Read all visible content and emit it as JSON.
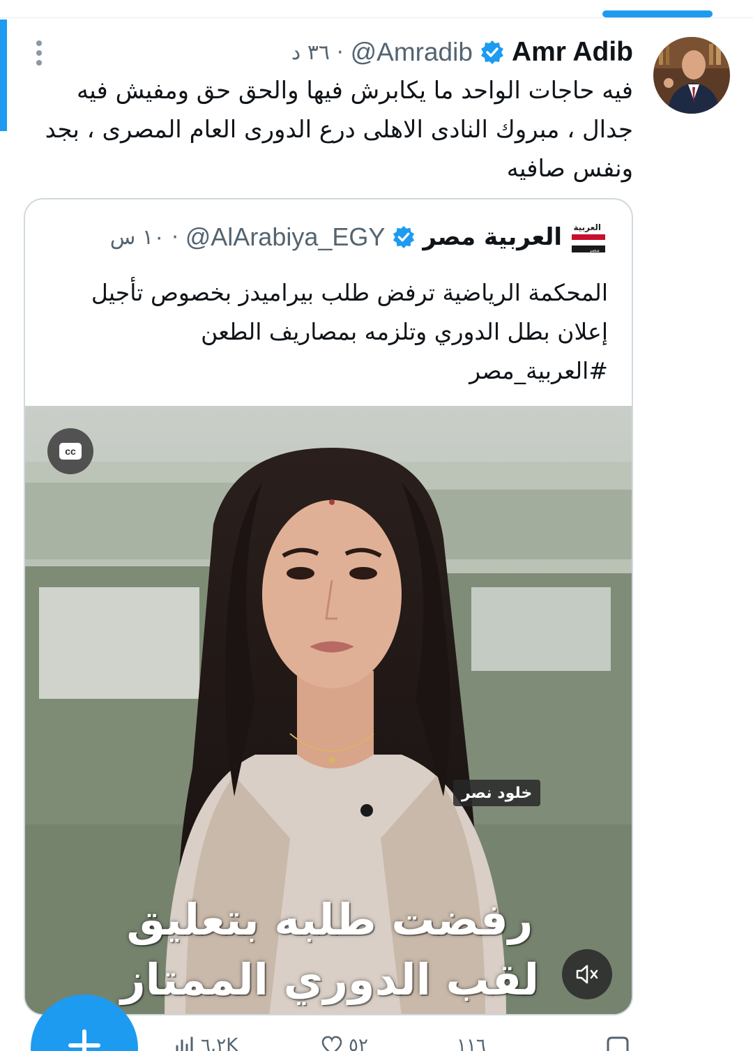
{
  "tweet": {
    "author_name": "Amr Adib",
    "handle": "@Amradib",
    "separator": "·",
    "time": "٣٦ د",
    "text_lines": [
      "فيه حاجات الواحد ما يكابرش فيها والحق حق ومفيش فيه",
      "جدال ، مبروك النادى الاهلى  درع الدورى العام المصرى ، بجد",
      "ونفس صافيه"
    ],
    "icons": {
      "verified": "verified-badge-icon",
      "more": "more-vertical-icon",
      "avatar": "profile-avatar"
    }
  },
  "quote": {
    "author_name": "العربية مصر",
    "handle": "@AlArabiya_EGY",
    "separator": "·",
    "time": "١٠ س",
    "text_lines": [
      "المحكمة الرياضية ترفض طلب بيراميدز بخصوص تأجيل",
      "إعلان بطل الدوري وتلزمه بمصاريف الطعن",
      "#العربية_مصر"
    ],
    "logo_text": "العربية",
    "logo_sub": "مصر",
    "video": {
      "cc_label": "cc",
      "name_tag": "خلود نصر",
      "caption_line1": "رفضت طلبه بتعليق",
      "caption_line2": "لقب الدوري الممتاز",
      "icons": {
        "cc": "closed-captions-icon",
        "mute": "volume-muted-icon"
      }
    }
  },
  "actions": {
    "reply": "١١٦",
    "likes": "٥٢",
    "views": "٦.٢K"
  },
  "colors": {
    "accent": "#1d9bf0",
    "text": "#0f1419",
    "secondary": "#536471",
    "border": "#cfd9de"
  }
}
